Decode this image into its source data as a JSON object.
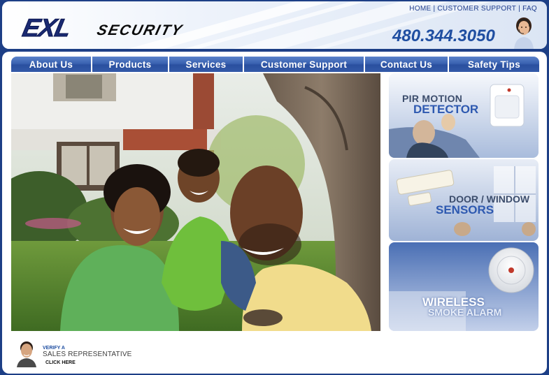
{
  "header": {
    "logo_main": "EXL",
    "logo_sub": "SECURITY",
    "top_links": [
      "HOME",
      "CUSTOMER SUPPORT",
      "FAQ"
    ],
    "separator": "|",
    "phone": "480.344.3050"
  },
  "nav": {
    "items": [
      "About Us",
      "Products",
      "Services",
      "Customer Support",
      "Contact Us",
      "Safety Tips"
    ]
  },
  "promos": [
    {
      "line1": "PIR MOTION",
      "line2": "DETECTOR"
    },
    {
      "line1": "DOOR / WINDOW",
      "line2": "SENSORS"
    },
    {
      "line1": "WIRELESS",
      "line2": "SMOKE ALARM"
    }
  ],
  "sales_rep": {
    "verify": "VERIFY A",
    "title": "SALES REPRESENTATIVE",
    "cta": "CLICK HERE"
  },
  "colors": {
    "background": "#1d3f86",
    "nav_blue": "#3a62b1",
    "phone_blue": "#1f4ea1",
    "logo_navy": "#1a2a72"
  }
}
